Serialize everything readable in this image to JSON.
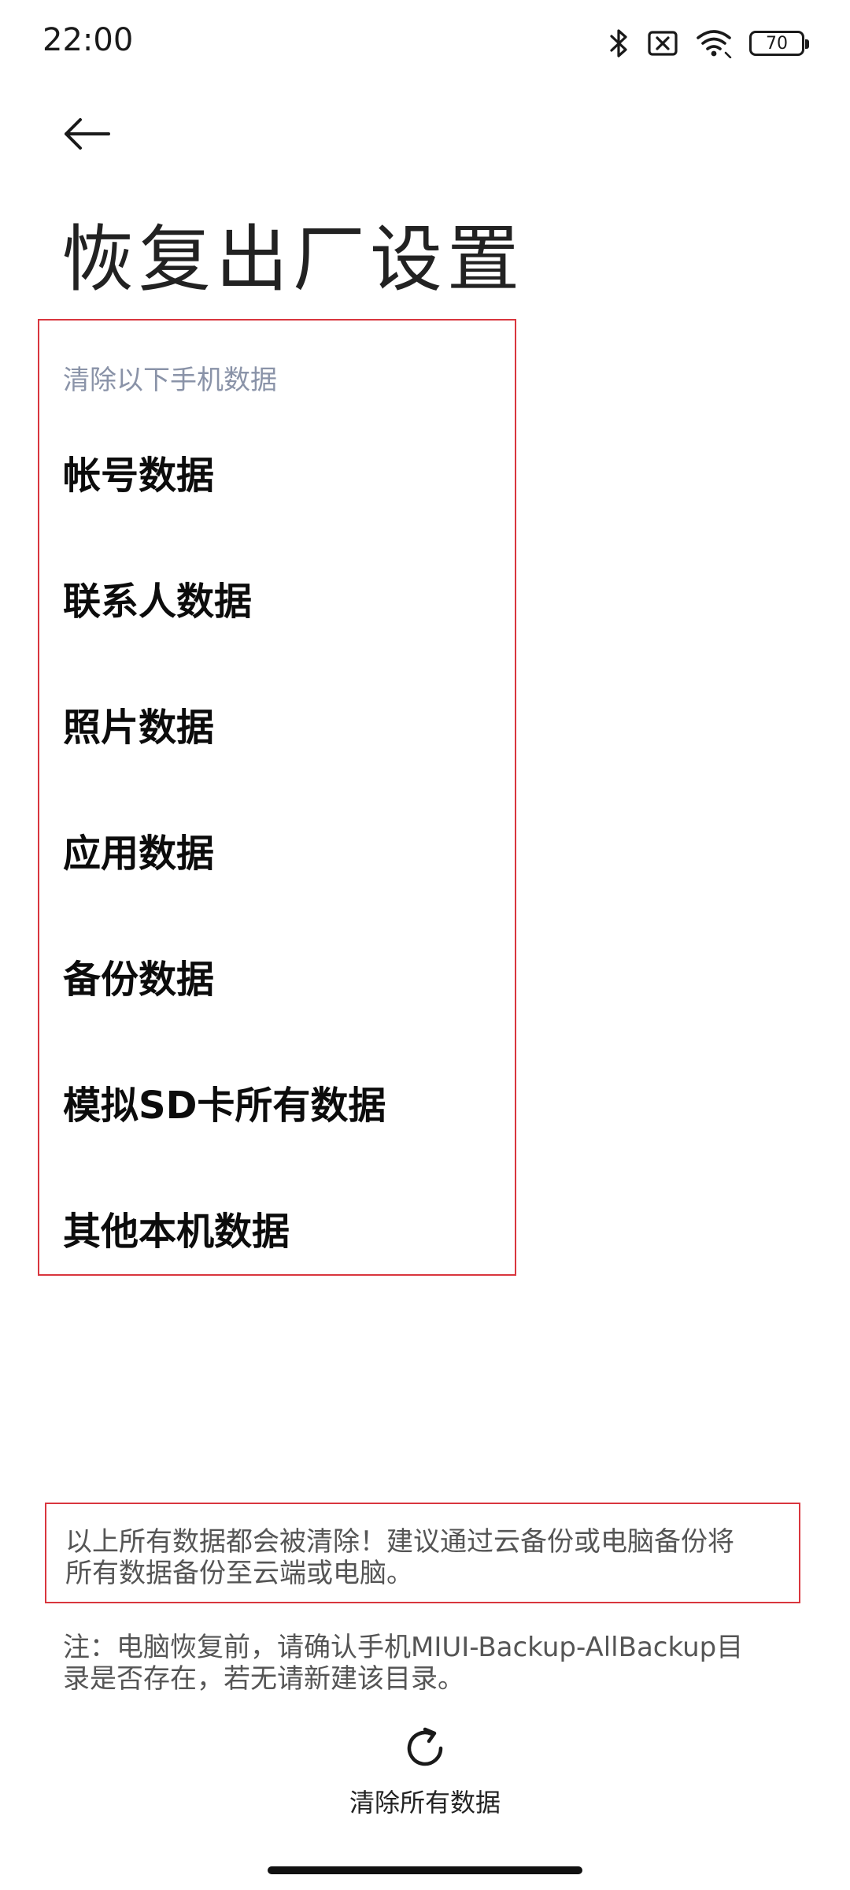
{
  "status_bar": {
    "time": "22:00",
    "battery": "70",
    "icons": [
      "bluetooth-icon",
      "no-sim-icon",
      "wifi-icon",
      "battery-icon"
    ]
  },
  "header": {
    "back_icon": "arrow-left-icon",
    "title": "恢复出厂设置"
  },
  "data_list": {
    "header": "清除以下手机数据",
    "items": [
      {
        "label": "帐号数据"
      },
      {
        "label": "联系人数据"
      },
      {
        "label": "照片数据"
      },
      {
        "label": "应用数据"
      },
      {
        "label": "备份数据"
      },
      {
        "label": "模拟SD卡所有数据"
      },
      {
        "label": "其他本机数据"
      }
    ]
  },
  "warning": {
    "line1": "以上所有数据都会被清除！建议通过云备份或电脑备份将",
    "line2": "所有数据备份至云端或电脑。"
  },
  "note": {
    "line1": "注：电脑恢复前，请确认手机MIUI-Backup-AllBackup目",
    "line2": "录是否存在，若无请新建该目录。"
  },
  "action": {
    "icon": "refresh-icon",
    "label": "清除所有数据"
  },
  "colors": {
    "highlight_border": "#d9363e",
    "section_header": "#8a93a8"
  }
}
